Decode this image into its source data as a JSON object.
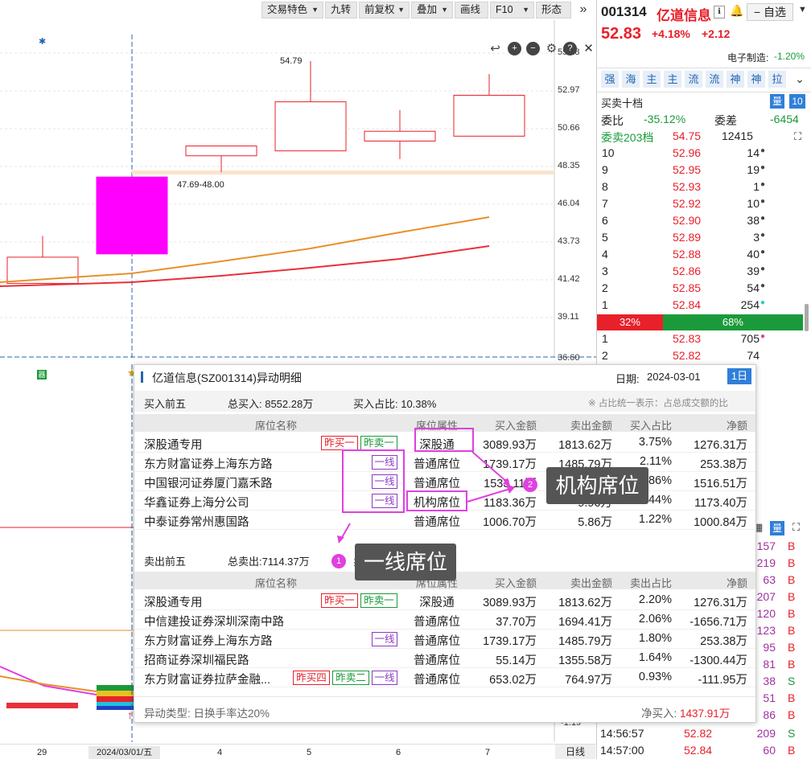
{
  "toolbar": {
    "buttons": [
      "交易特色",
      "九转",
      "前复权",
      "叠加",
      "画线",
      "F10",
      "形态"
    ]
  },
  "chart": {
    "price_labels": [
      "55.28",
      "52.97",
      "50.66",
      "48.35",
      "46.04",
      "43.73",
      "41.42",
      "39.11",
      "36.60"
    ],
    "annot_high": "54.79",
    "annot_range": "47.69-48.00",
    "candles": [
      {
        "open": 42.8,
        "close": 41.2,
        "high": 44.1,
        "low": 41.2,
        "color": "#e8202a",
        "fill": "#ffffff"
      },
      {
        "open": 43.0,
        "close": 47.7,
        "high": 47.7,
        "low": 43.0,
        "color": "#ff00ff",
        "fill": "#ff00ff"
      },
      {
        "open": 49.0,
        "close": 49.6,
        "high": 49.6,
        "low": 48.0,
        "color": "#e8202a",
        "fill": "#ffffff"
      },
      {
        "open": 49.3,
        "close": 52.3,
        "high": 54.79,
        "low": 49.3,
        "color": "#e8202a",
        "fill": "#ffffff"
      },
      {
        "open": 49.9,
        "close": 50.5,
        "high": 51.8,
        "low": 48.8,
        "color": "#e8202a",
        "fill": "#ffffff"
      },
      {
        "open": 50.2,
        "close": 52.7,
        "high": 54.0,
        "low": 50.2,
        "color": "#e8202a",
        "fill": "#ffffff"
      }
    ],
    "ma1_color": "#e8902a",
    "ma2_color": "#e8303a"
  },
  "xaxis": {
    "labels": [
      "29",
      "2024/03/01/五",
      "4",
      "5",
      "6",
      "7"
    ],
    "period": "日线"
  },
  "lower": {
    "sub_values": [
      "-1.19"
    ]
  },
  "right": {
    "code": "001314",
    "name": "亿道信息",
    "watch": "自选",
    "price": "52.83",
    "chg_pct": "+4.18%",
    "chg": "+2.12",
    "industry": "电子制造:",
    "industry_chg": "-1.20%",
    "tabs": [
      "强",
      "海",
      "主",
      "主",
      "流",
      "流",
      "神",
      "神",
      "拉"
    ],
    "orderbook_title": "买卖十档",
    "ob_badge1": "量",
    "ob_badge2": "10",
    "weibi_label": "委比",
    "weibi": "-35.12%",
    "weicha_label": "委差",
    "weicha": "-6454",
    "wm_label": "委卖203档",
    "wm_price": "54.75",
    "wm_vol": "12415",
    "asks": [
      {
        "lvl": "10",
        "price": "52.96",
        "vol": "14"
      },
      {
        "lvl": "9",
        "price": "52.95",
        "vol": "19"
      },
      {
        "lvl": "8",
        "price": "52.93",
        "vol": "1"
      },
      {
        "lvl": "7",
        "price": "52.92",
        "vol": "10"
      },
      {
        "lvl": "6",
        "price": "52.90",
        "vol": "38"
      },
      {
        "lvl": "5",
        "price": "52.89",
        "vol": "3"
      },
      {
        "lvl": "4",
        "price": "52.88",
        "vol": "40"
      },
      {
        "lvl": "3",
        "price": "52.86",
        "vol": "39"
      },
      {
        "lvl": "2",
        "price": "52.85",
        "vol": "54"
      },
      {
        "lvl": "1",
        "price": "52.84",
        "vol": "254"
      }
    ],
    "ratio_buy": "32%",
    "ratio_sell": "68%",
    "ratio_buy_frac": 0.32,
    "bids": [
      {
        "lvl": "1",
        "price": "52.83",
        "vol": "705"
      },
      {
        "lvl": "2",
        "price": "52.82",
        "vol": "74"
      }
    ],
    "trade_badge": "量",
    "trades": [
      {
        "vol": "157",
        "side": "B"
      },
      {
        "vol": "219",
        "side": "B"
      },
      {
        "vol": "63",
        "side": "B"
      },
      {
        "vol": "207",
        "side": "B"
      },
      {
        "vol": "120",
        "side": "B"
      },
      {
        "vol": "123",
        "side": "B"
      },
      {
        "vol": "95",
        "side": "B"
      },
      {
        "vol": "81",
        "side": "B"
      },
      {
        "vol": "38",
        "side": "S"
      },
      {
        "vol": "51",
        "side": "B"
      },
      {
        "vol": "86",
        "side": "B"
      }
    ],
    "trade_full": [
      {
        "time": "14:56:57",
        "price": "52.82",
        "vol": "209",
        "side": "S"
      },
      {
        "time": "14:57:00",
        "price": "52.84",
        "vol": "60",
        "side": "B"
      }
    ]
  },
  "popup": {
    "title": "亿道信息(SZ001314)异动明细",
    "date_label": "日期:",
    "date": "2024-03-01",
    "day_btn": "1日",
    "buy_section": {
      "title": "买入前五",
      "total_label": "总买入: 8552.28万",
      "ratio_label": "买入占比: 10.38%",
      "note": "※ 占比统一表示：占总成交额的比"
    },
    "buy_headers": [
      "席位名称",
      "席位属性",
      "买入金额",
      "卖出金额",
      "买入占比",
      "净额"
    ],
    "buy_rows": [
      {
        "name": "深股通专用",
        "tags": [
          {
            "t": "昨买一",
            "c": "r"
          },
          {
            "t": "昨卖一",
            "c": "g"
          }
        ],
        "attr": "深股通",
        "buy": "3089.93万",
        "sell": "1813.62万",
        "ratio": "3.75%",
        "net": "1276.31万"
      },
      {
        "name": "东方财富证券上海东方路",
        "tags": [
          {
            "t": "一线",
            "c": "p"
          }
        ],
        "attr": "普通席位",
        "buy": "1739.17万",
        "sell": "1485.79万",
        "ratio": "2.11%",
        "net": "253.38万"
      },
      {
        "name": "中国银河证券厦门嘉禾路",
        "tags": [
          {
            "t": "一线",
            "c": "p"
          }
        ],
        "attr": "普通席位",
        "buy": "1533.11万",
        "sell": "16.60万",
        "ratio": "1.86%",
        "net": "1516.51万"
      },
      {
        "name": "华鑫证券上海分公司",
        "tags": [
          {
            "t": "一线",
            "c": "p"
          }
        ],
        "attr": "机构席位",
        "buy": "1183.36万",
        "sell": "9.96万",
        "ratio": "1.44%",
        "net": "1173.40万"
      },
      {
        "name": "中泰证券常州惠国路",
        "tags": [],
        "attr": "普通席位",
        "buy": "1006.70万",
        "sell": "5.86万",
        "ratio": "1.22%",
        "net": "1000.84万"
      }
    ],
    "sell_section": {
      "title": "卖出前五",
      "total_label": "总卖出:7114.37万",
      "ratio_label": "卖出"
    },
    "sell_headers": [
      "席位名称",
      "席位属性",
      "买入金额",
      "卖出金额",
      "卖出占比",
      "净额"
    ],
    "sell_rows": [
      {
        "name": "深股通专用",
        "tags": [
          {
            "t": "昨买一",
            "c": "r"
          },
          {
            "t": "昨卖一",
            "c": "g"
          }
        ],
        "attr": "深股通",
        "buy": "3089.93万",
        "sell": "1813.62万",
        "ratio": "2.20%",
        "net": "1276.31万"
      },
      {
        "name": "中信建投证券深圳深南中路",
        "tags": [],
        "attr": "普通席位",
        "buy": "37.70万",
        "sell": "1694.41万",
        "ratio": "2.06%",
        "net": "-1656.71万"
      },
      {
        "name": "东方财富证券上海东方路",
        "tags": [
          {
            "t": "一线",
            "c": "p"
          }
        ],
        "attr": "普通席位",
        "buy": "1739.17万",
        "sell": "1485.79万",
        "ratio": "1.80%",
        "net": "253.38万"
      },
      {
        "name": "招商证券深圳福民路",
        "tags": [],
        "attr": "普通席位",
        "buy": "55.14万",
        "sell": "1355.58万",
        "ratio": "1.64%",
        "net": "-1300.44万"
      },
      {
        "name": "东方财富证券拉萨金融...",
        "tags": [
          {
            "t": "昨买四",
            "c": "r"
          },
          {
            "t": "昨卖二",
            "c": "g"
          },
          {
            "t": "一线",
            "c": "p"
          }
        ],
        "attr": "普通席位",
        "buy": "653.02万",
        "sell": "764.97万",
        "ratio": "0.93%",
        "net": "-111.95万"
      }
    ],
    "footer_type": "异动类型: 日换手率达20%",
    "footer_net": "净买入: 1437.91万",
    "annot_jigou": "机构席位",
    "annot_yixian": "一线席位",
    "annot_n1": "1",
    "annot_n2": "2"
  }
}
